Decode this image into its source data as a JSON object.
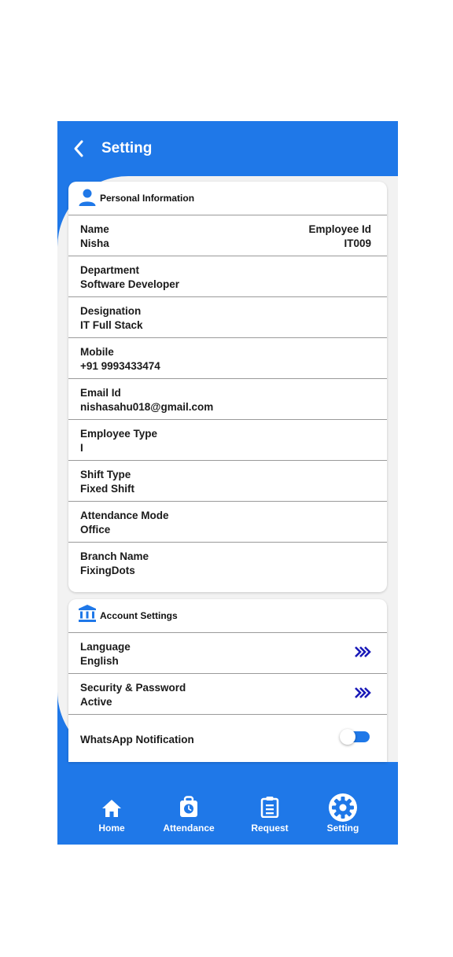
{
  "header": {
    "title": "Setting"
  },
  "personal": {
    "heading": "Personal Information",
    "name_label": "Name",
    "name_value": "Nisha",
    "empid_label": "Employee Id",
    "empid_value": "IT009",
    "rows": [
      {
        "label": "Department",
        "value": "Software Developer"
      },
      {
        "label": "Designation",
        "value": "IT Full Stack"
      },
      {
        "label": "Mobile",
        "value": "+91 9993433474"
      },
      {
        "label": "Email Id",
        "value": "nishasahu018@gmail.com"
      },
      {
        "label": "Employee Type",
        "value": "I"
      },
      {
        "label": "Shift Type",
        "value": "Fixed Shift"
      },
      {
        "label": "Attendance Mode",
        "value": "Office"
      },
      {
        "label": "Branch Name",
        "value": "FixingDots"
      }
    ]
  },
  "account": {
    "heading": "Account Settings",
    "language_label": "Language",
    "language_value": "English",
    "security_label": "Security & Password",
    "security_value": "Active",
    "whatsapp_label": "WhatsApp Notification",
    "whatsapp_enabled": true
  },
  "nav": {
    "home": "Home",
    "attendance": "Attendance",
    "request": "Request",
    "setting": "Setting"
  },
  "colors": {
    "primary": "#1f78e8",
    "chevron": "#1a1ab8"
  }
}
